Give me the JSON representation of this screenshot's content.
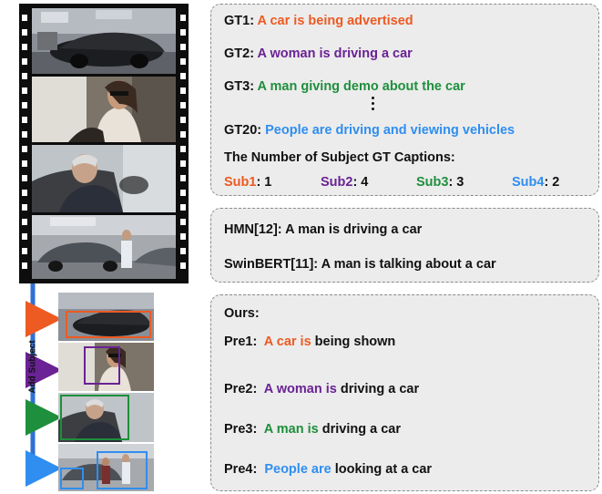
{
  "gt_panel": {
    "gt1_prefix": "GT1: ",
    "gt1_text": "A car is being advertised",
    "gt2_prefix": "GT2: ",
    "gt2_text": "A woman is driving a car",
    "gt3_prefix": "GT3: ",
    "gt3_text": "A man giving demo about the car",
    "gt20_prefix": "GT20: ",
    "gt20_text": "People are driving and viewing vehicles",
    "count_heading": "The Number of Subject GT Captions:",
    "subjects": [
      {
        "label": "Sub1",
        "value": ": 1"
      },
      {
        "label": "Sub2",
        "value": ": 4"
      },
      {
        "label": "Sub3",
        "value": ": 3"
      },
      {
        "label": "Sub4",
        "value": ": 2"
      }
    ]
  },
  "baseline_panel": {
    "hmn": "HMN[12]: A man is driving a car",
    "swinbert": "SwinBERT[11]: A man is talking about a car"
  },
  "ours_panel": {
    "title": "Ours:",
    "preds": [
      {
        "prefix": "Pre1:  ",
        "subject": "A car is",
        "rest": " being shown"
      },
      {
        "prefix": "Pre2:  ",
        "subject": "A woman is",
        "rest": " driving a car"
      },
      {
        "prefix": "Pre3:  ",
        "subject": "A man is",
        "rest": " driving a car"
      },
      {
        "prefix": "Pre4:  ",
        "subject": "People are",
        "rest": " looking at a car"
      }
    ]
  },
  "side_label": "Add Subject",
  "colors": {
    "sub1": "#ed5a22",
    "sub2": "#6a2294",
    "sub3": "#1e8f3c",
    "sub4": "#2f8ef0",
    "connector": "#2f6fd6"
  }
}
